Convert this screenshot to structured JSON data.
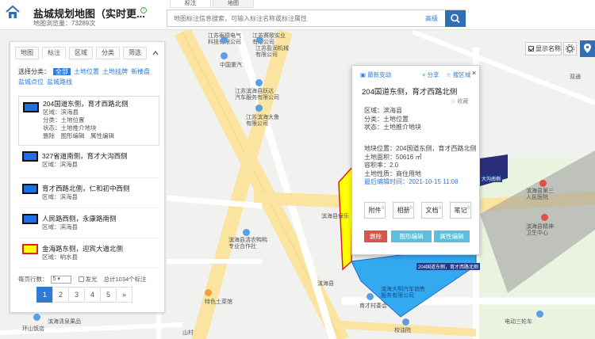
{
  "header": {
    "app_title": "盐城规划地图（实时更...",
    "visits": "地图浏览量：73289次",
    "top_tabs": [
      "标注",
      "地图"
    ],
    "search_placeholder": "地图标注信息搜索，可输入标注名称或标注属性",
    "advanced": "高级"
  },
  "controls": {
    "show_name": "显示名称"
  },
  "panel": {
    "tabs": [
      "地图",
      "标注",
      "区域",
      "分类",
      "筛选"
    ],
    "categories_label": "选择分类：",
    "categories": [
      "全部",
      "土地位置",
      "土地挂牌",
      "新楼盘",
      "盐城点位",
      "盐城路线"
    ],
    "items": [
      {
        "title": "204国道东侧，育才西路北侧",
        "district": "区域：滨海县",
        "category": "分类：土地位置",
        "status": "状态：土地推介地块",
        "actions": "删除　图形编辑　属性编辑",
        "color": "#1f6fe0",
        "border": "#111111"
      },
      {
        "title": "327省道南侧，育才大沟西侧",
        "district": "区域：滨海县",
        "color": "#1f6fe0",
        "border": "#111111"
      },
      {
        "title": "育才西路北侧，仁和初中西侧",
        "district": "区域：滨海县",
        "color": "#1f6fe0",
        "border": "#111111"
      },
      {
        "title": "人民路西侧，永康路南侧",
        "district": "区域：滨海县",
        "color": "#1f6fe0",
        "border": "#111111"
      },
      {
        "title": "金海路东侧，迎宾大道北侧",
        "district": "区域：响水县",
        "color": "#ffff00",
        "border": "#e02020"
      }
    ],
    "per_page_label": "每页行数：",
    "per_page_value": "5",
    "flash_label": "发光",
    "total": "总计1034个标注",
    "pages": [
      "1",
      "2",
      "3",
      "4",
      "5",
      "»"
    ]
  },
  "popup": {
    "latest": "最新变动",
    "share": "分享",
    "search_area": "搜区域",
    "close": "×",
    "title": "204国道东侧，育才西路北侧",
    "favorite": "☆ 收藏",
    "district": "区域：滨海县",
    "category": "分类：土地位置",
    "status": "状态：土地推介地块",
    "location": "地块位置：204国道东侧，育才西路北侧",
    "area": "土地面积：50616 ㎡",
    "plot_ratio": "容积率：2.0",
    "land_use": "土地性质：商住用地",
    "edit_time_label": "最后编辑时间：",
    "edit_time": "2021-10-15 11:08",
    "buttons": [
      {
        "label": "附件",
        "count": "0"
      },
      {
        "label": "相册",
        "count": "0"
      },
      {
        "label": "文档",
        "count": "0"
      },
      {
        "label": "笔记",
        "count": "0"
      }
    ],
    "delete": "删除",
    "geo_edit": "图形编辑",
    "attr_edit": "属性编辑"
  },
  "map_labels": {
    "l1": "江苏赛歌实业\n有限公司",
    "l2": "江苏泰德电气\n科技有限公司",
    "l3": "江苏盈润机械\n有限公司",
    "l4": "中国重汽",
    "l5": "江苏滨海县跃达\n汽车服务有限公司",
    "l6": "江苏滨海大鲁\n有限公司",
    "l7": "滨海县第三\n人民医院",
    "l8": "滨海县精神\n卫生中心",
    "l9": "滨海县清农鸭鸭\n专业合作社",
    "l10": "特色土菜馆",
    "l11": "育才村委会",
    "l12": "滨海大明汽车销售\n服务有限公司",
    "l13": "校油院",
    "l14": "滨海清泉果品",
    "l15": "环山饭店",
    "l16": "电动三轮车",
    "l17": "204国道东侧，育才西路北侧",
    "l18": "大沟南侧",
    "l19": "双通",
    "l20": "滨海县保乐",
    "l21": "滨海县",
    "l22": "山村"
  }
}
